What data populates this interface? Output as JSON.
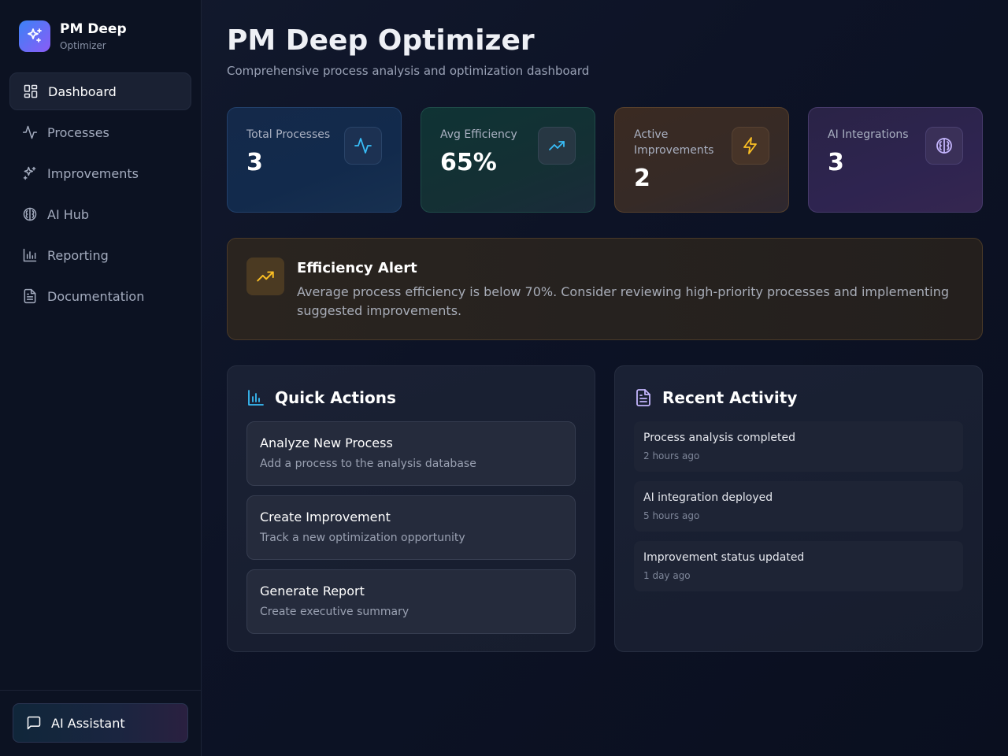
{
  "brand": {
    "title": "PM Deep",
    "subtitle": "Optimizer"
  },
  "sidebar": {
    "items": [
      {
        "label": "Dashboard",
        "icon": "grid-icon",
        "active": true
      },
      {
        "label": "Processes",
        "icon": "activity-icon"
      },
      {
        "label": "Improvements",
        "icon": "sparkles-icon"
      },
      {
        "label": "AI Hub",
        "icon": "brain-icon"
      },
      {
        "label": "Reporting",
        "icon": "bar-chart-icon"
      },
      {
        "label": "Documentation",
        "icon": "file-text-icon"
      }
    ],
    "assistant_label": "AI Assistant"
  },
  "header": {
    "title": "PM Deep Optimizer",
    "subtitle": "Comprehensive process analysis and optimization dashboard"
  },
  "stats": [
    {
      "label": "Total Processes",
      "value": "3",
      "icon": "activity-icon",
      "color": "#38bdf8"
    },
    {
      "label": "Avg Efficiency",
      "value": "65%",
      "icon": "trending-up-icon",
      "color": "#38bdf8"
    },
    {
      "label": "Active Improvements",
      "value": "2",
      "icon": "zap-icon",
      "color": "#fbbf24"
    },
    {
      "label": "AI Integrations",
      "value": "3",
      "icon": "brain-icon",
      "color": "#c4b5fd"
    }
  ],
  "alert": {
    "title": "Efficiency Alert",
    "body": "Average process efficiency is below 70%. Consider reviewing high-priority processes and implementing suggested improvements."
  },
  "quick_actions": {
    "title": "Quick Actions",
    "items": [
      {
        "title": "Analyze New Process",
        "desc": "Add a process to the analysis database"
      },
      {
        "title": "Create Improvement",
        "desc": "Track a new optimization opportunity"
      },
      {
        "title": "Generate Report",
        "desc": "Create executive summary"
      }
    ]
  },
  "recent_activity": {
    "title": "Recent Activity",
    "items": [
      {
        "title": "Process analysis completed",
        "time": "2 hours ago"
      },
      {
        "title": "AI integration deployed",
        "time": "5 hours ago"
      },
      {
        "title": "Improvement status updated",
        "time": "1 day ago"
      }
    ]
  },
  "colors": {
    "accent_blue": "#38bdf8",
    "accent_amber": "#fbbf24",
    "accent_violet": "#c4b5fd",
    "brand_gradient_start": "#3b82f6",
    "brand_gradient_end": "#8b5cf6"
  }
}
